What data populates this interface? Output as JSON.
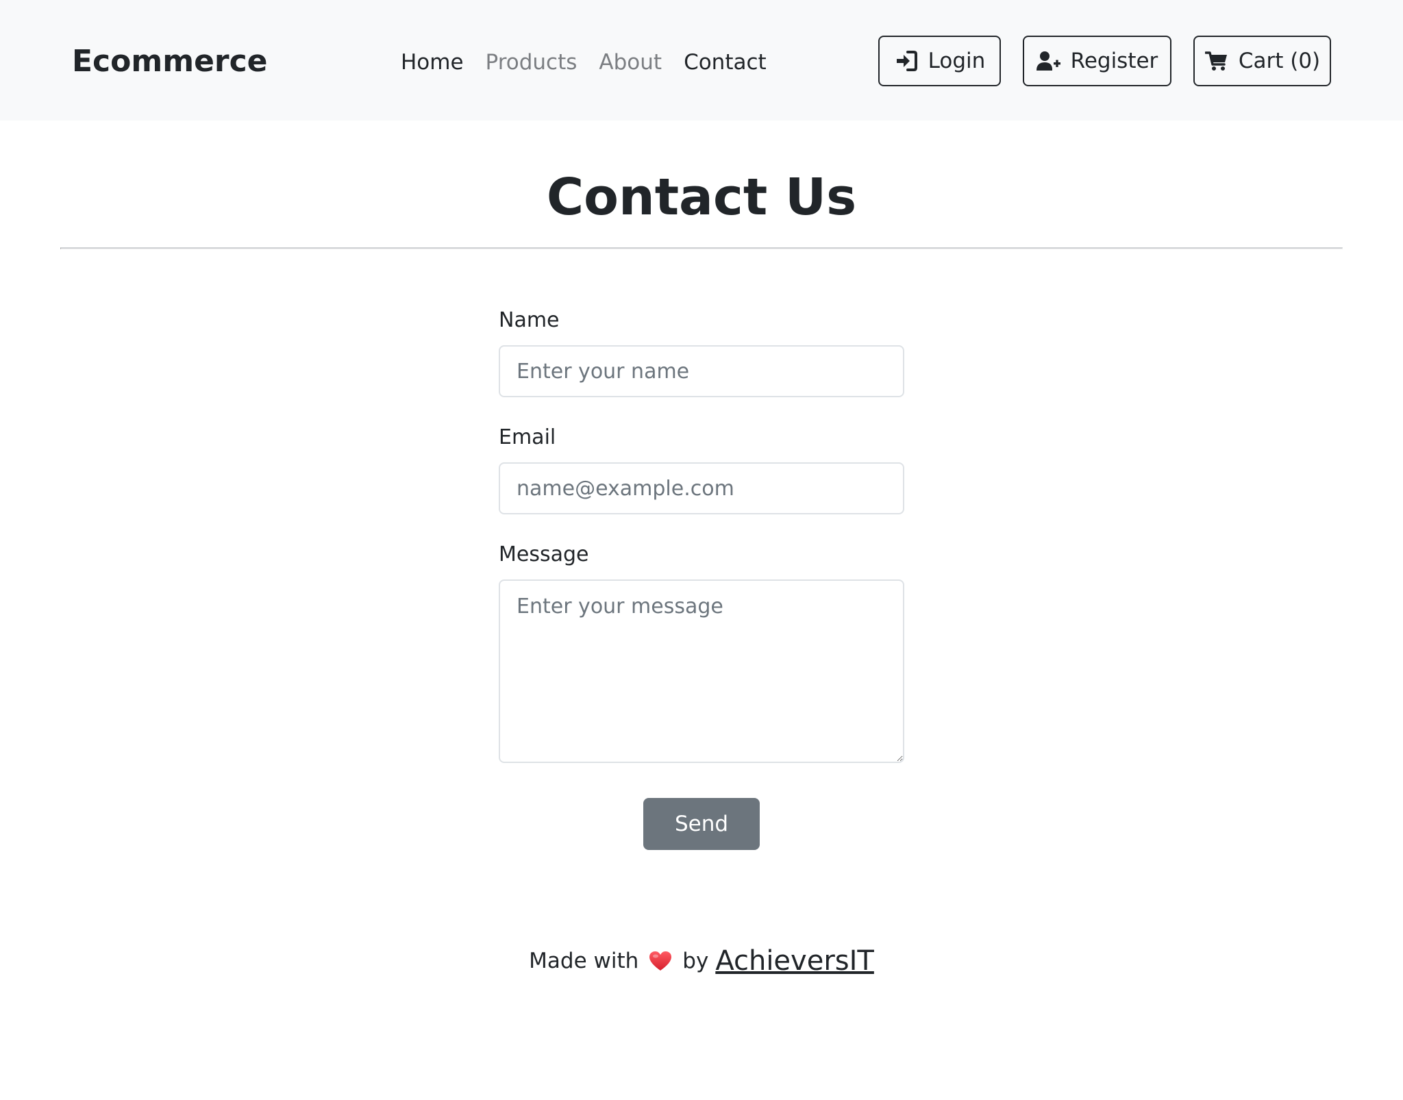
{
  "navbar": {
    "brand": "Ecommerce",
    "links": [
      {
        "label": "Home",
        "state": "active"
      },
      {
        "label": "Products",
        "state": "muted"
      },
      {
        "label": "About",
        "state": "muted"
      },
      {
        "label": "Contact",
        "state": "active"
      }
    ],
    "buttons": {
      "login": {
        "label": "Login",
        "icon": "sign-in-icon"
      },
      "register": {
        "label": "Register",
        "icon": "user-plus-icon"
      },
      "cart": {
        "label": "Cart (0)",
        "icon": "cart-icon"
      }
    }
  },
  "page": {
    "title": "Contact Us"
  },
  "form": {
    "name": {
      "label": "Name",
      "value": "",
      "placeholder": "Enter your name"
    },
    "email": {
      "label": "Email",
      "value": "",
      "placeholder": "name@example.com"
    },
    "message": {
      "label": "Message",
      "value": "",
      "placeholder": "Enter your message"
    },
    "send_label": "Send"
  },
  "footer": {
    "made_with": "Made with",
    "by": "by",
    "link_text": "AchieversIT",
    "heart_icon": "heart-icon"
  },
  "colors": {
    "navbar_bg": "#f8f9fa",
    "text_dark": "#212529",
    "text_muted": "#7b7e82",
    "send_button_bg": "#6c757d",
    "heart": "#e8303a"
  }
}
